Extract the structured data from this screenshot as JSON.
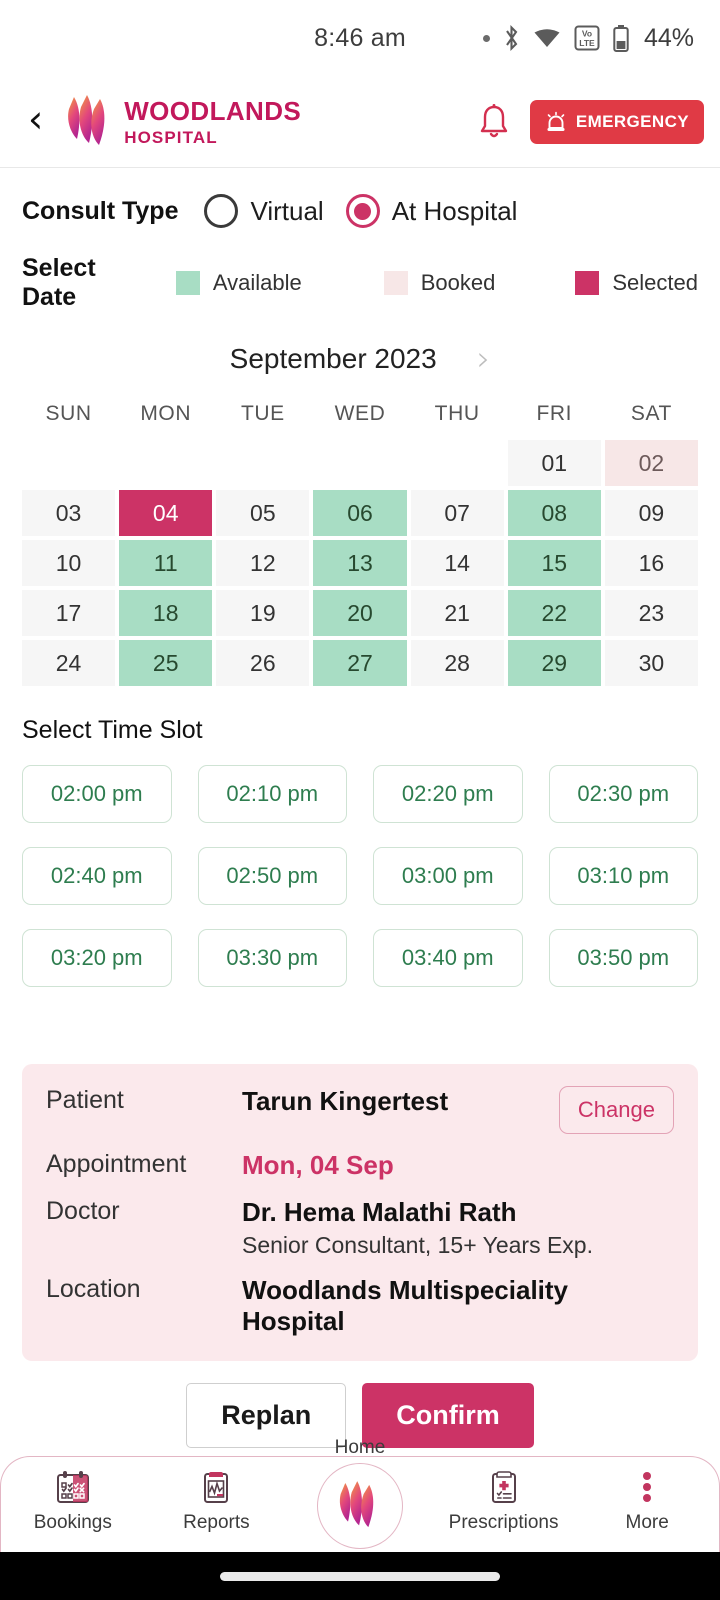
{
  "status_bar": {
    "time": "8:46 am",
    "battery": "44%",
    "icons": [
      "dot-icon",
      "bluetooth-icon",
      "wifi-icon",
      "volte-icon",
      "battery-icon"
    ]
  },
  "header": {
    "back_icon": "chevron-left-icon",
    "brand_line1": "WOODLANDS",
    "brand_line2": "HOSPITAL",
    "bell_icon": "notification-bell-icon",
    "emergency_label": "EMERGENCY",
    "emergency_icon": "siren-icon",
    "emergency_color": "#e03a45",
    "brand_color": "#c2185b"
  },
  "consult": {
    "label": "Consult Type",
    "options": [
      {
        "label": "Virtual",
        "selected": false
      },
      {
        "label": "At Hospital",
        "selected": true
      }
    ]
  },
  "select_date": {
    "label": "Select Date",
    "legend": [
      {
        "label": "Available",
        "color": "#a8ddc4"
      },
      {
        "label": "Booked",
        "color": "#f7e7e7"
      },
      {
        "label": "Selected",
        "color": "#cc3366"
      }
    ]
  },
  "calendar": {
    "month": "September 2023",
    "next_icon": "chevron-right-icon",
    "day_headers": [
      "SUN",
      "MON",
      "TUE",
      "WED",
      "THU",
      "FRI",
      "SAT"
    ],
    "weeks": [
      [
        {
          "day": "",
          "state": "empty"
        },
        {
          "day": "",
          "state": "empty"
        },
        {
          "day": "",
          "state": "empty"
        },
        {
          "day": "",
          "state": "empty"
        },
        {
          "day": "",
          "state": "empty"
        },
        {
          "day": "01",
          "state": "default"
        },
        {
          "day": "02",
          "state": "booked"
        }
      ],
      [
        {
          "day": "03",
          "state": "default"
        },
        {
          "day": "04",
          "state": "sel"
        },
        {
          "day": "05",
          "state": "default"
        },
        {
          "day": "06",
          "state": "avail"
        },
        {
          "day": "07",
          "state": "default"
        },
        {
          "day": "08",
          "state": "avail"
        },
        {
          "day": "09",
          "state": "default"
        }
      ],
      [
        {
          "day": "10",
          "state": "default"
        },
        {
          "day": "11",
          "state": "avail"
        },
        {
          "day": "12",
          "state": "default"
        },
        {
          "day": "13",
          "state": "avail"
        },
        {
          "day": "14",
          "state": "default"
        },
        {
          "day": "15",
          "state": "avail"
        },
        {
          "day": "16",
          "state": "default"
        }
      ],
      [
        {
          "day": "17",
          "state": "default"
        },
        {
          "day": "18",
          "state": "avail"
        },
        {
          "day": "19",
          "state": "default"
        },
        {
          "day": "20",
          "state": "avail"
        },
        {
          "day": "21",
          "state": "default"
        },
        {
          "day": "22",
          "state": "avail"
        },
        {
          "day": "23",
          "state": "default"
        }
      ],
      [
        {
          "day": "24",
          "state": "default"
        },
        {
          "day": "25",
          "state": "avail"
        },
        {
          "day": "26",
          "state": "default"
        },
        {
          "day": "27",
          "state": "avail"
        },
        {
          "day": "28",
          "state": "default"
        },
        {
          "day": "29",
          "state": "avail"
        },
        {
          "day": "30",
          "state": "default"
        }
      ]
    ]
  },
  "time_slots": {
    "title": "Select Time Slot",
    "slots": [
      "02:00 pm",
      "02:10 pm",
      "02:20 pm",
      "02:30 pm",
      "02:40 pm",
      "02:50 pm",
      "03:00 pm",
      "03:10 pm",
      "03:20 pm",
      "03:30 pm",
      "03:40 pm",
      "03:50 pm"
    ]
  },
  "summary": {
    "patient_label": "Patient",
    "patient_value": "Tarun Kingertest",
    "change_label": "Change",
    "appointment_label": "Appointment",
    "appointment_value": "Mon, 04 Sep",
    "doctor_label": "Doctor",
    "doctor_value": "Dr. Hema Malathi Rath",
    "doctor_sub": "Senior Consultant, 15+ Years Exp.",
    "location_label": "Location",
    "location_value": "Woodlands Multispeciality Hospital"
  },
  "actions": {
    "replan_label": "Replan",
    "confirm_label": "Confirm",
    "confirm_color": "#cc3366"
  },
  "bottom_nav": {
    "items": [
      {
        "label": "Bookings",
        "icon": "calendar-icon"
      },
      {
        "label": "Reports",
        "icon": "clipboard-chart-icon"
      },
      {
        "label": "Home",
        "icon": "flame-logo-icon"
      },
      {
        "label": "Prescriptions",
        "icon": "clipboard-medical-icon"
      },
      {
        "label": "More",
        "icon": "more-dots-icon"
      }
    ]
  }
}
